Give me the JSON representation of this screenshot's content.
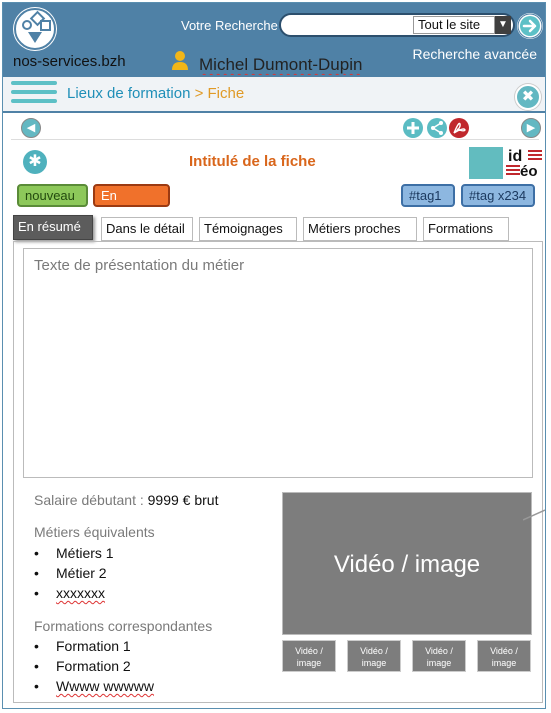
{
  "header": {
    "site_name": "nos-services.bzh",
    "search_label": "Votre Recherche",
    "search_value": "",
    "search_scope": "Tout le site",
    "advanced_search": "Recherche avancée",
    "user_name": "Michel Dumont-Dupin"
  },
  "breadcrumb": {
    "parent": "Lieux de formation",
    "separator": ">",
    "current": "Fiche"
  },
  "fiche": {
    "title": "Intitulé de la fiche",
    "status_badges": [
      "nouveau",
      "En tension"
    ],
    "tags": [
      "#tag1",
      "#tag x234"
    ],
    "partner_logo_text": "idéo"
  },
  "tabs": [
    "En résumé",
    "Dans le détail",
    "Témoignages",
    "Métiers proches",
    "Formations"
  ],
  "active_tab": "En résumé",
  "content": {
    "presentation_text": "Texte de présentation du métier",
    "salary_label": "Salaire débutant :",
    "salary_value": "9999 € brut",
    "equivalent_jobs_label": "Métiers équivalents",
    "equivalent_jobs": [
      "Métiers 1",
      "Métier 2",
      "xxxxxxx"
    ],
    "formations_label": "Formations correspondantes",
    "formations": [
      "Formation 1",
      "Formation 2",
      "Wwww wwwww"
    ],
    "video_main_label": "Vidéo / image",
    "video_thumbs": [
      "Vidéo / image",
      "Vidéo / image",
      "Vidéo / image",
      "Vidéo / image"
    ]
  },
  "icons": {
    "logo": "shapes-logo-icon",
    "search_go": "arrow-right-circle-icon",
    "user": "user-icon",
    "menu": "hamburger-menu-icon",
    "close": "close-icon",
    "prev": "chevron-left-icon",
    "next": "chevron-right-icon",
    "add": "plus-circle-icon",
    "share": "share-icon",
    "pdf": "pdf-icon",
    "asterisk": "asterisk-icon"
  },
  "colors": {
    "header_bg": "#4f81a6",
    "accent_teal": "#5dc0c6",
    "title_orange": "#d9661b",
    "badge_new": "#8dc85a",
    "badge_tension": "#f0712b",
    "tag_blue": "#8db7e0"
  }
}
